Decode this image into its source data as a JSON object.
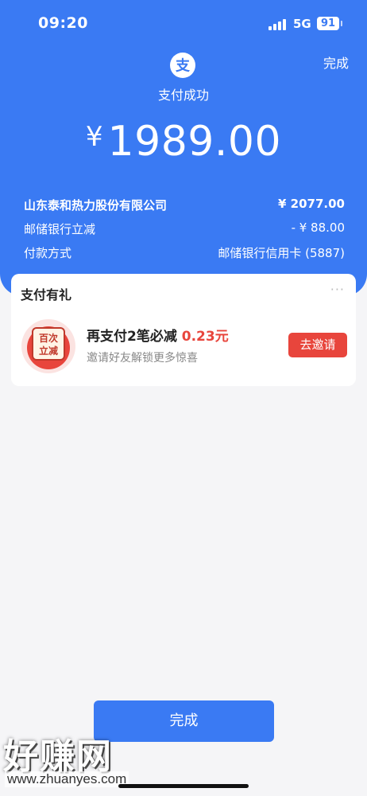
{
  "status_bar": {
    "time": "09:20",
    "network": "5G",
    "battery": "91"
  },
  "header": {
    "done_label": "完成",
    "logo_glyph": "支",
    "title": "支付成功",
    "currency_symbol": "¥",
    "amount": "1989.00",
    "background_color": "#3a7af3"
  },
  "details": [
    {
      "label": "山东泰和热力股份有限公司",
      "value": "¥ 2077.00"
    },
    {
      "label": "邮储银行立减",
      "value": "- ¥ 88.00"
    },
    {
      "label": "付款方式",
      "value": "邮储银行信用卡 (5887)"
    }
  ],
  "gift_card": {
    "title": "支付有礼",
    "more_icon": "more-dots-icon",
    "badge_line1": "百次",
    "badge_line2": "立减",
    "main_text": "再支付2笔必减",
    "main_amount": "0.23元",
    "subtitle": "邀请好友解锁更多惊喜",
    "invite_label": "去邀请",
    "accent_color": "#e8453c"
  },
  "footer": {
    "done_label": "完成"
  },
  "watermark": {
    "text": "好赚网",
    "url": "www.zhuanyes.com"
  }
}
